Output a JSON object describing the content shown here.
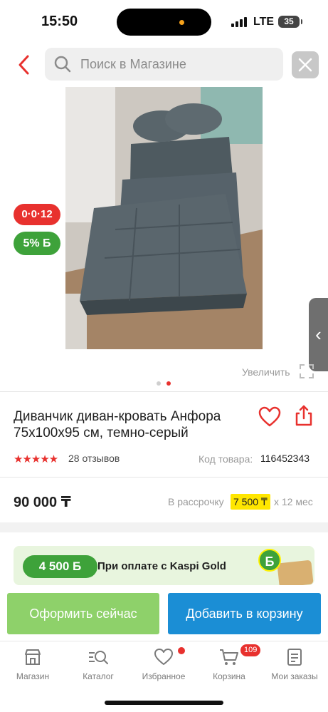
{
  "status_bar": {
    "time": "15:50",
    "network": "LTE",
    "battery": "35"
  },
  "search": {
    "placeholder": "Поиск в Магазине"
  },
  "product": {
    "title": "Диванчик диван-кровать Анфора 75x100x95 см, темно-серый",
    "installment_badge": "0·0·12",
    "bonus_badge": "5% Б",
    "zoom_label": "Увеличить",
    "gallery": {
      "count": 2,
      "active": 2
    },
    "rating": 5,
    "reviews": "28 отзывов",
    "code_label": "Код товара:",
    "code": "116452343",
    "price": "90 000 ₸",
    "installment_label": "В рассрочку",
    "installment_amount": "7 500 ₸",
    "installment_term": "x 12 мес"
  },
  "kaspi_gold": {
    "bonus": "4 500 Б",
    "text": "При оплате с Kaspi Gold",
    "coin": "Б"
  },
  "buttons": {
    "buy_now": "Оформить сейчас",
    "add_to_cart": "Добавить в корзину"
  },
  "tabbar": {
    "items": [
      {
        "label": "Магазин",
        "icon": "shop-icon"
      },
      {
        "label": "Каталог",
        "icon": "catalog-icon"
      },
      {
        "label": "Избранное",
        "icon": "heart-icon"
      },
      {
        "label": "Корзина",
        "icon": "cart-icon"
      },
      {
        "label": "Мои заказы",
        "icon": "orders-icon"
      }
    ],
    "cart_count": "109"
  },
  "colors": {
    "accent": "#e8312e",
    "green": "#3ea23a",
    "blue": "#1b8ed5",
    "light_green": "#8ed16a",
    "yellow": "#ffe600"
  }
}
